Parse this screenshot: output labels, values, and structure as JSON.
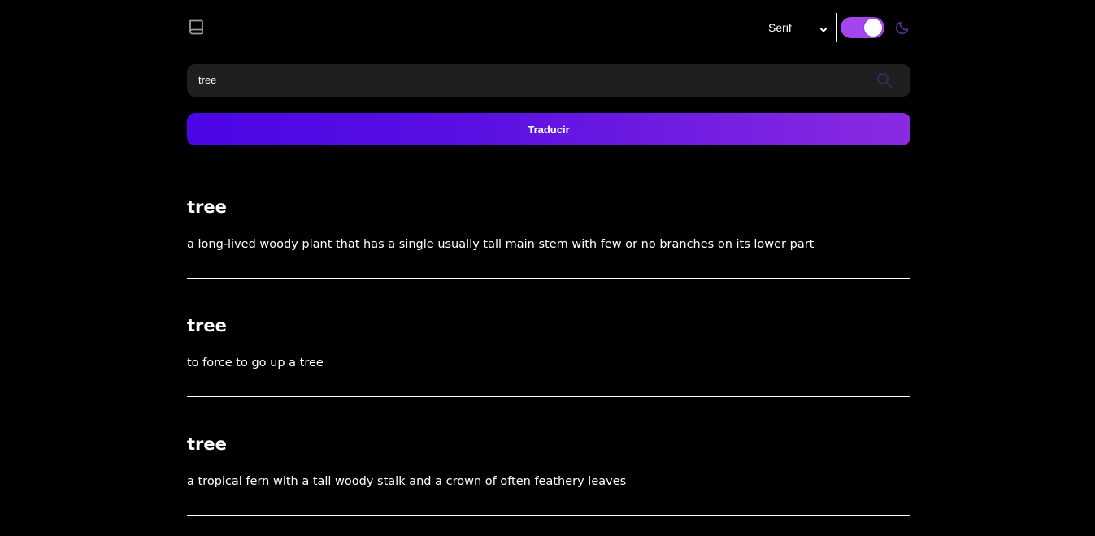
{
  "header": {
    "logo_icon": "book-icon",
    "font_select": {
      "selected": "Serif"
    },
    "theme_toggle": {
      "on": true,
      "accent": "#a445ed"
    },
    "moon_icon": "moon-icon"
  },
  "search": {
    "value": "tree",
    "icon": "search-icon"
  },
  "translate_button": {
    "label": "Traducir"
  },
  "results": [
    {
      "word": "tree",
      "definition": "a long-lived woody plant that has a single usually tall main stem with few or no branches on its lower part"
    },
    {
      "word": "tree",
      "definition": "to force to go up a tree"
    },
    {
      "word": "tree",
      "definition": "a tropical fern with a tall woody stalk and a crown of often feathery leaves"
    }
  ],
  "colors": {
    "background": "#000000",
    "input_background": "#1f1f1f",
    "gradient_start": "#4a06e4",
    "gradient_end": "#8a2be2"
  }
}
